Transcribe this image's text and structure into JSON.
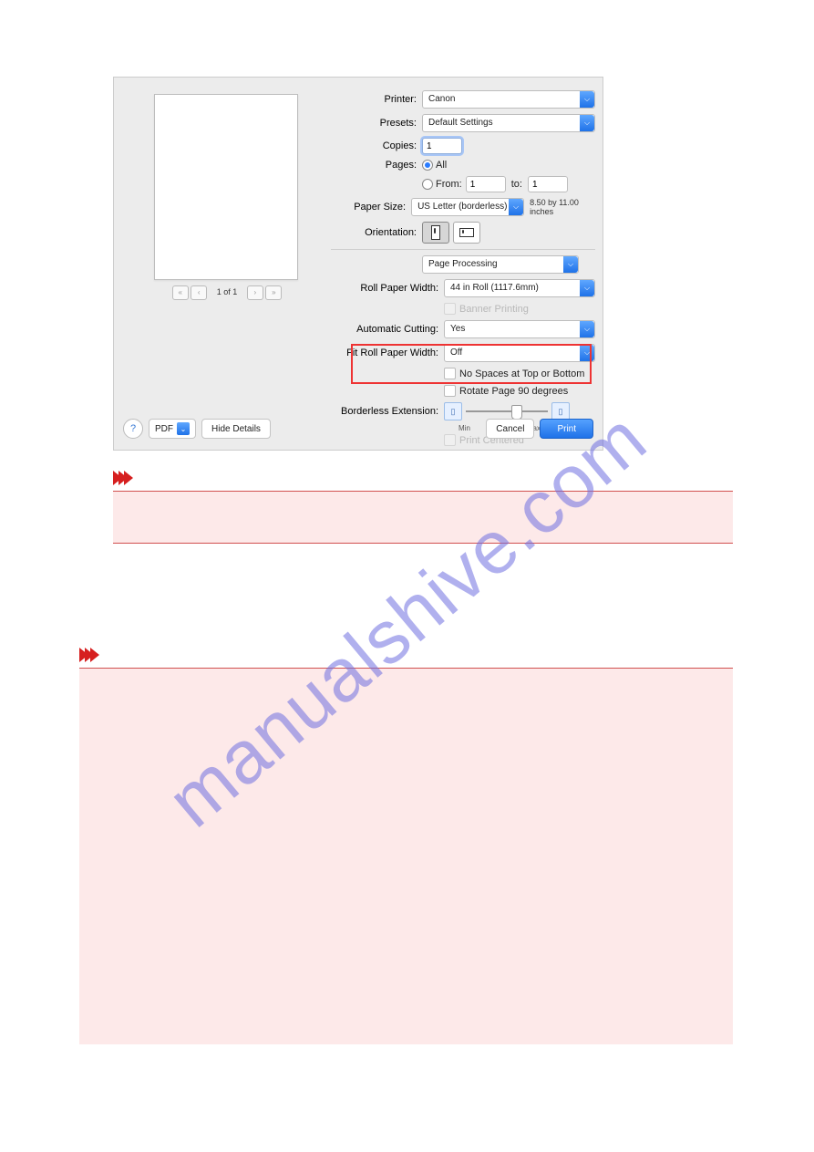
{
  "dialog": {
    "printer_label": "Printer:",
    "printer_value": "Canon",
    "presets_label": "Presets:",
    "presets_value": "Default Settings",
    "copies_label": "Copies:",
    "copies_value": "1",
    "pages_label": "Pages:",
    "pages_all": "All",
    "pages_from": "From:",
    "pages_from_value": "1",
    "pages_to": "to:",
    "pages_to_value": "1",
    "paper_size_label": "Paper Size:",
    "paper_size_value": "US Letter (borderless)",
    "paper_size_dim": "8.50 by 11.00 inches",
    "orientation_label": "Orientation:",
    "section_value": "Page Processing",
    "roll_width_label": "Roll Paper Width:",
    "roll_width_value": "44 in Roll (1117.6mm)",
    "banner_label": "Banner Printing",
    "auto_cut_label": "Automatic Cutting:",
    "auto_cut_value": "Yes",
    "fit_roll_label": "Fit Roll Paper Width:",
    "fit_roll_value": "Off",
    "no_spaces_label": "No Spaces at Top or Bottom",
    "rotate_label": "Rotate Page 90 degrees",
    "borderless_ext_label": "Borderless Extension:",
    "slider_min": "Min",
    "slider_max": "Max",
    "print_centered_label": "Print Centered",
    "page_nav_label": "1 of 1",
    "help": "?",
    "pdf": "PDF",
    "hide_details": "Hide Details",
    "cancel": "Cancel",
    "print": "Print"
  },
  "watermark": "manualshive.com"
}
